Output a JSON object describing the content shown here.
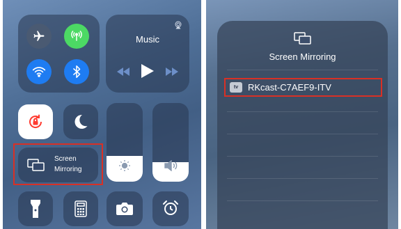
{
  "left_panel": {
    "music": {
      "title": "Music"
    },
    "screen_mirroring": {
      "line1": "Screen",
      "line2": "Mirroring"
    },
    "brightness_level": 0.33,
    "volume_level": 0.25
  },
  "right_panel": {
    "title": "Screen Mirroring",
    "devices": [
      {
        "badge": "tv",
        "name": "RKcast-C7AEF9-ITV"
      }
    ]
  },
  "colors": {
    "airplane": "#4a5a72",
    "cellular": "#4cd964",
    "wifi": "#1e7cf2",
    "bluetooth": "#1e7cf2",
    "rotation_lock_bg": "#ffffff",
    "rotation_lock_icon": "#ff3b30",
    "highlight_border": "#d93025"
  }
}
